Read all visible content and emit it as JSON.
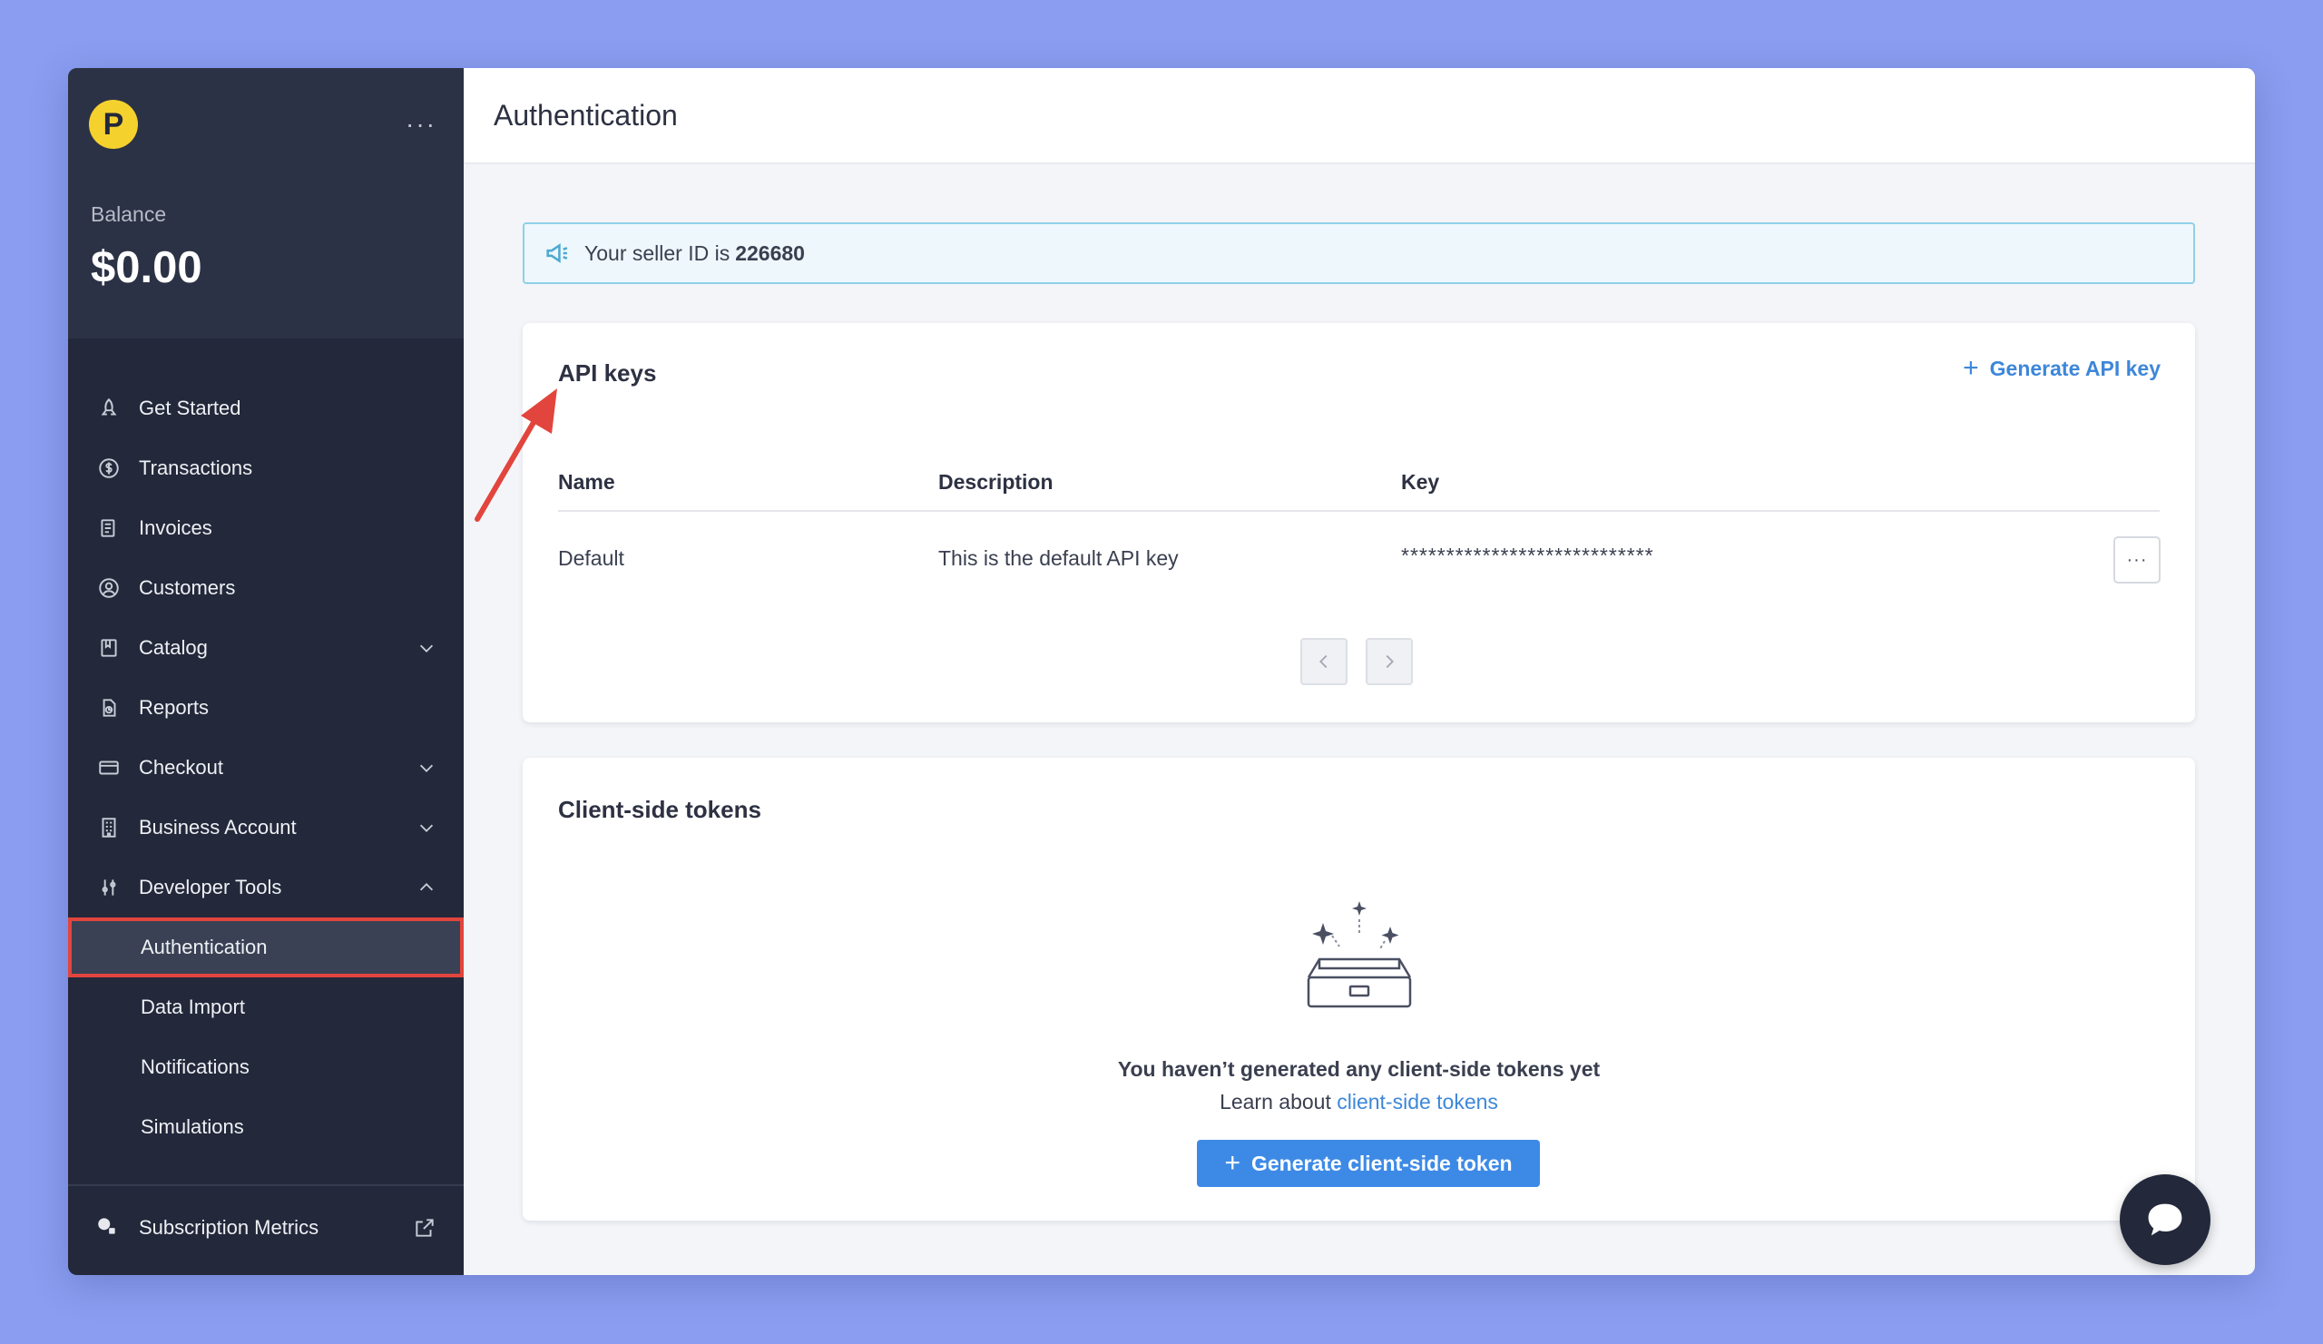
{
  "sidebar": {
    "logo_letter": "P",
    "balance_label": "Balance",
    "balance_value": "$0.00",
    "nav": [
      {
        "label": "Get Started",
        "icon": "rocket-icon"
      },
      {
        "label": "Transactions",
        "icon": "dollar-circle-icon"
      },
      {
        "label": "Invoices",
        "icon": "document-icon"
      },
      {
        "label": "Customers",
        "icon": "user-circle-icon"
      },
      {
        "label": "Catalog",
        "icon": "catalog-icon"
      },
      {
        "label": "Reports",
        "icon": "reports-icon"
      },
      {
        "label": "Checkout",
        "icon": "credit-card-icon"
      },
      {
        "label": "Business Account",
        "icon": "building-icon"
      },
      {
        "label": "Developer Tools",
        "icon": "sliders-icon"
      }
    ],
    "sub_items": [
      {
        "label": "Authentication",
        "active": true
      },
      {
        "label": "Data Import"
      },
      {
        "label": "Notifications"
      },
      {
        "label": "Simulations"
      }
    ],
    "footer_item": "Subscription Metrics"
  },
  "header": {
    "title": "Authentication"
  },
  "notice": {
    "prefix": "Your seller ID is",
    "seller_id": "226680"
  },
  "api_keys": {
    "title": "API keys",
    "generate_label": "Generate API key",
    "columns": [
      "Name",
      "Description",
      "Key"
    ],
    "rows": [
      {
        "name": "Default",
        "description": "This is the default API key",
        "key": "****************************"
      }
    ]
  },
  "tokens": {
    "title": "Client-side tokens",
    "empty_title": "You haven’t generated any client-side tokens yet",
    "learn_prefix": "Learn about",
    "learn_link": "client-side tokens",
    "button_label": "Generate client-side token"
  },
  "colors": {
    "background": "#8a9df0",
    "sidebar": "#23283a",
    "accent_blue": "#3d8ae6",
    "logo_yellow": "#f5d12e",
    "annotation_red": "#e2453d"
  }
}
